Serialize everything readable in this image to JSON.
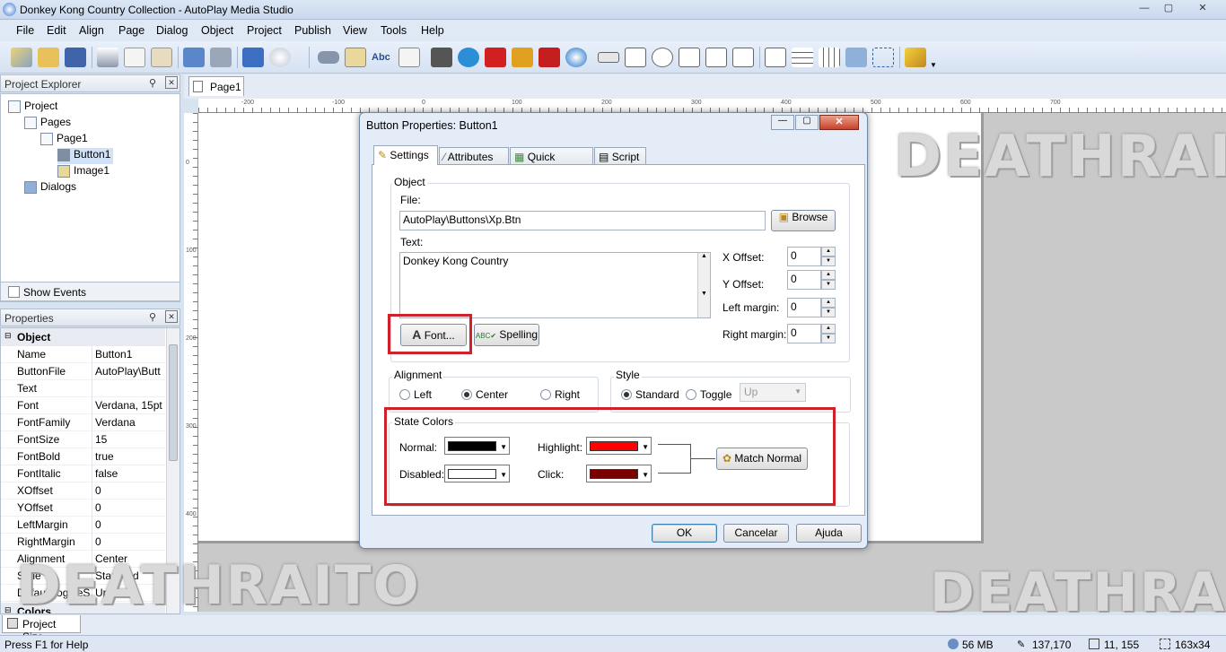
{
  "window": {
    "title": "Donkey Kong Country Collection - AutoPlay Media Studio",
    "min": "—",
    "max": "▢",
    "close": "✕"
  },
  "menu": [
    "File",
    "Edit",
    "Align",
    "Page",
    "Dialog",
    "Object",
    "Project",
    "Publish",
    "View",
    "Tools",
    "Help"
  ],
  "explorer": {
    "title": "Project Explorer",
    "tree": [
      "Project",
      "Pages",
      "Page1",
      "Button1",
      "Image1",
      "Dialogs"
    ],
    "show_events": "Show Events"
  },
  "properties": {
    "title": "Properties",
    "section": "Object",
    "rows": [
      {
        "name": "Name",
        "value": "Button1"
      },
      {
        "name": "ButtonFile",
        "value": "AutoPlay\\Butt"
      },
      {
        "name": "Text",
        "value": ""
      },
      {
        "name": "Font",
        "value": "Verdana, 15pt"
      },
      {
        "name": "FontFamily",
        "value": "Verdana"
      },
      {
        "name": "FontSize",
        "value": "15"
      },
      {
        "name": "FontBold",
        "value": "true"
      },
      {
        "name": "FontItalic",
        "value": "false"
      },
      {
        "name": "XOffset",
        "value": "0"
      },
      {
        "name": "YOffset",
        "value": "0"
      },
      {
        "name": "LeftMargin",
        "value": "0"
      },
      {
        "name": "RightMargin",
        "value": "0"
      },
      {
        "name": "Alignment",
        "value": "Center"
      },
      {
        "name": "Style",
        "value": "Standard"
      },
      {
        "name": "DefaultToggleS",
        "value": "Up"
      }
    ],
    "colors_section": "Colors"
  },
  "project_size_tab": "Project Size",
  "page_tab": "Page1",
  "ruler": {
    "top": [
      "-200",
      "-100",
      "0",
      "100",
      "200",
      "300",
      "400",
      "500",
      "600",
      "700"
    ],
    "left": [
      "0",
      "100",
      "200",
      "300",
      "400"
    ]
  },
  "dialog": {
    "title": "Button Properties: Button1",
    "tabs": [
      "Settings",
      "Attributes",
      "Quick Action",
      "Script"
    ],
    "object_group": "Object",
    "file_label": "File:",
    "file_value": "AutoPlay\\Buttons\\Xp.Btn",
    "browse": "Browse",
    "text_label": "Text:",
    "text_value": "Donkey Kong Country",
    "x_offset_label": "X Offset:",
    "x_offset": "0",
    "y_offset_label": "Y Offset:",
    "y_offset": "0",
    "left_margin_label": "Left margin:",
    "left_margin": "0",
    "right_margin_label": "Right margin:",
    "right_margin": "0",
    "font_btn": "Font...",
    "spelling_btn": "Spelling",
    "alignment_group": "Alignment",
    "align_left": "Left",
    "align_center": "Center",
    "align_right": "Right",
    "style_group": "Style",
    "style_standard": "Standard",
    "style_toggle": "Toggle",
    "toggle_state": "Up",
    "state_colors_group": "State Colors",
    "normal_label": "Normal:",
    "disabled_label": "Disabled:",
    "highlight_label": "Highlight:",
    "click_label": "Click:",
    "colors": {
      "normal": "#000000",
      "disabled": "#ffffff",
      "highlight": "#ff0000",
      "click": "#7a0000"
    },
    "match_normal": "Match Normal",
    "ok": "OK",
    "cancel": "Cancelar",
    "help": "Ajuda"
  },
  "status": {
    "help": "Press F1 for Help",
    "memory": "56 MB",
    "position": "137,170",
    "coords": "11, 155",
    "size": "163x34"
  },
  "watermark": "DEATHRAITO",
  "accent": {
    "highlight_box": "#d0202a"
  }
}
